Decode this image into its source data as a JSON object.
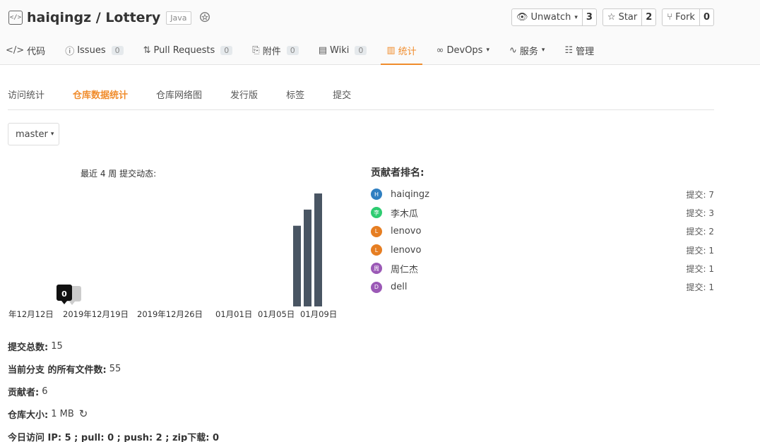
{
  "repo": {
    "owner_name": "haiqingz / Lottery",
    "language": "Java"
  },
  "actions": [
    {
      "label": "Unwatch",
      "count": "3"
    },
    {
      "label": "Star",
      "count": "2"
    },
    {
      "label": "Fork",
      "count": "0"
    }
  ],
  "nav": [
    {
      "label": "代码",
      "icon": "code-icon"
    },
    {
      "label": "Issues",
      "badge": "0",
      "icon": "issue-icon"
    },
    {
      "label": "Pull Requests",
      "badge": "0",
      "icon": "pull-request-icon"
    },
    {
      "label": "附件",
      "badge": "0",
      "icon": "attachment-icon"
    },
    {
      "label": "Wiki",
      "badge": "0",
      "icon": "book-icon"
    },
    {
      "label": "统计",
      "icon": "chart-icon"
    },
    {
      "label": "DevOps",
      "icon": "infinity-icon"
    },
    {
      "label": "服务",
      "icon": "pulse-icon"
    },
    {
      "label": "管理",
      "icon": "settings-icon"
    }
  ],
  "sub_nav": [
    "访问统计",
    "仓库数据统计",
    "仓库网络图",
    "发行版",
    "标签",
    "提交"
  ],
  "branch": "master",
  "chart_data": {
    "type": "bar",
    "title": "最近 4 周 提交动态:",
    "x_labels": [
      "年12月12日",
      "2019年12月19日",
      "2019年12月26日",
      "01月01日",
      "01月05日",
      "01月09日"
    ],
    "values": [
      5,
      6,
      7
    ],
    "tooltip_value": "0",
    "ylim": [
      0,
      7
    ],
    "colors": {
      "bar": "#495563",
      "tooltip": "#111111",
      "tooltip_ghost": "#cccccc"
    }
  },
  "contributors": {
    "title": "贡献者排名:",
    "count_prefix": "提交: ",
    "items": [
      {
        "name": "haiqingz",
        "initial": "H",
        "count": "7",
        "color": "#2f7fc1"
      },
      {
        "name": "李木瓜",
        "initial": "李",
        "count": "3",
        "color": "#2ecc71"
      },
      {
        "name": "lenovo",
        "initial": "L",
        "count": "2",
        "color": "#e67e22"
      },
      {
        "name": "lenovo",
        "initial": "L",
        "count": "1",
        "color": "#e67e22"
      },
      {
        "name": "周仁杰",
        "initial": "周",
        "count": "1",
        "color": "#9b59b6"
      },
      {
        "name": "dell",
        "initial": "D",
        "count": "1",
        "color": "#9b59b6"
      }
    ]
  },
  "stats": {
    "total_commits_label": "提交总数:",
    "total_commits": "15",
    "files_label": "当前分支 的所有文件数:",
    "files": "55",
    "contributors_label": "贡献者:",
    "contributors": "6",
    "size_label": "仓库大小:",
    "size": "1 MB",
    "visits": "今日访问 IP: 5 ; pull: 0 ; push: 2 ; zip下载: 0"
  },
  "colors": {
    "accent": "#f08c2c"
  }
}
